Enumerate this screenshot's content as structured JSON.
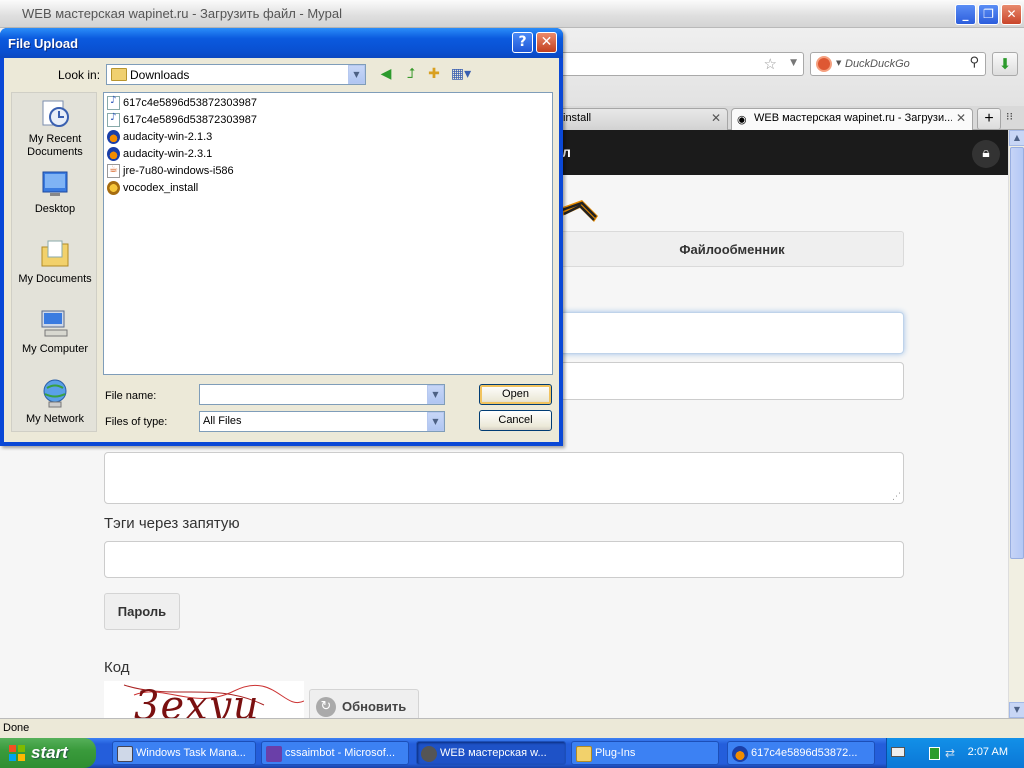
{
  "browser": {
    "window_title": "WEB мастерская wapinet.ru - Загрузить файл - Mypal",
    "search_placeholder": "DuckDuckGo",
    "tabs": [
      {
        "label": "install",
        "active": false
      },
      {
        "label": "WEB мастерская wapinet.ru - Загрузи...",
        "active": true
      }
    ],
    "status_text": "Done"
  },
  "page": {
    "header_fragment": "л",
    "files_nav_label": "Файлообменник",
    "tags_label": "Тэги через запятую",
    "password_button": "Пароль",
    "code_label": "Код",
    "captcha_text": "3ехуи",
    "refresh_button": "Обновить"
  },
  "dialog": {
    "title": "File Upload",
    "look_in_label": "Look in:",
    "look_in_value": "Downloads",
    "places": [
      {
        "label": "My Recent Documents",
        "icon": "recent-documents-icon"
      },
      {
        "label": "Desktop",
        "icon": "desktop-icon"
      },
      {
        "label": "My Documents",
        "icon": "my-documents-icon"
      },
      {
        "label": "My Computer",
        "icon": "my-computer-icon"
      },
      {
        "label": "My Network",
        "icon": "my-network-icon"
      }
    ],
    "files": [
      {
        "name": "617c4e5896d53872303987",
        "icon": "note"
      },
      {
        "name": "617c4e5896d53872303987",
        "icon": "note"
      },
      {
        "name": "audacity-win-2.1.3",
        "icon": "audacity"
      },
      {
        "name": "audacity-win-2.3.1",
        "icon": "audacity"
      },
      {
        "name": "jre-7u80-windows-i586",
        "icon": "java"
      },
      {
        "name": "vocodex_install",
        "icon": "installer"
      }
    ],
    "file_name_label": "File name:",
    "file_name_value": "",
    "files_of_type_label": "Files of type:",
    "files_of_type_value": "All Files",
    "open_button": "Open",
    "cancel_button": "Cancel"
  },
  "taskbar": {
    "start_label": "start",
    "tasks": [
      {
        "label": "Windows Task Mana...",
        "active": false
      },
      {
        "label": "cssaimbot - Microsof...",
        "active": false
      },
      {
        "label": "WEB мастерская w...",
        "active": true
      },
      {
        "label": "Plug-Ins",
        "active": false
      },
      {
        "label": "617c4e5896d53872...",
        "active": false
      }
    ],
    "clock": "2:07 AM"
  },
  "colors": {
    "xp_blue": "#245edb",
    "dialog_title_blue": "#0a4fd0",
    "site_header": "#1b1b1b",
    "start_green": "#3a9b3c"
  }
}
